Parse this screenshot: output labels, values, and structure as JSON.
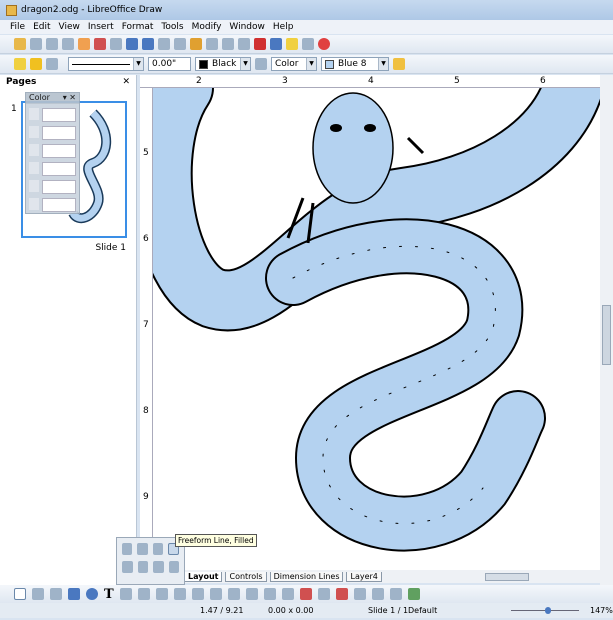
{
  "window": {
    "title": "dragon2.odg - LibreOffice Draw"
  },
  "menu": [
    "File",
    "Edit",
    "View",
    "Insert",
    "Format",
    "Tools",
    "Modify",
    "Window",
    "Help"
  ],
  "line_toolbar": {
    "line_width": "0.00\"",
    "line_color": "Black",
    "line_color_hex": "#000000",
    "area_style": "Color",
    "area_color": "Blue 8",
    "area_color_hex": "#b4d2f0"
  },
  "pages_panel": {
    "title": "Pages",
    "page_number": "1",
    "slide_label": "Slide 1"
  },
  "color_palette": {
    "title": "Color"
  },
  "ruler": {
    "h": [
      "2",
      "3",
      "4",
      "5",
      "6"
    ],
    "v": [
      "5",
      "6",
      "7",
      "8",
      "9"
    ]
  },
  "layer_tabs": [
    "Layout",
    "Controls",
    "Dimension Lines",
    "Layer4"
  ],
  "tooltip": "Freeform Line, Filled",
  "status": {
    "position": "1.47 / 9.21",
    "size": "0.00 x 0.00",
    "slide": "Slide 1 / 1",
    "layout": "Default",
    "zoom": "147%",
    "zoom_level": 0.55
  },
  "colors": {
    "dragon_fill": "#b4d2f0",
    "outline": "#000000",
    "selection": "#3a8ee6"
  }
}
